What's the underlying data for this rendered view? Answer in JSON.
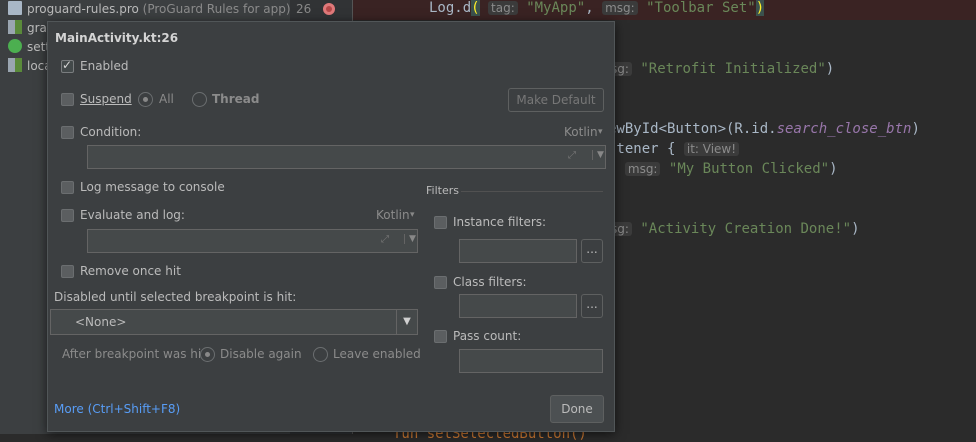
{
  "tree": {
    "items": [
      {
        "label": "proguard-rules.pro",
        "hint": "(ProGuard Rules for app)",
        "icon": "file-icon"
      },
      {
        "label": "grad",
        "hint": "",
        "icon": "gradle-icon"
      },
      {
        "label": "setti",
        "hint": "",
        "icon": "settings-gradle-icon"
      },
      {
        "label": "loca",
        "hint": "",
        "icon": "properties-icon"
      }
    ]
  },
  "gutter": {
    "line_number": "26"
  },
  "code": {
    "line1": {
      "fn": "Log.d",
      "tag_hint": "tag:",
      "tag": "\"MyApp\"",
      "msg_hint": "msg:",
      "msg": "\"Toolbar Set\""
    },
    "line2": {
      "msg_hint": "sg:",
      "msg": "\"Retrofit Initialized\""
    },
    "line3": {
      "pre": "ewById<Button>(R.id.",
      "id": "search_close_btn",
      "post": ")"
    },
    "line4": {
      "pre": "stener {",
      "hint": "it: View!"
    },
    "line5": {
      "pre": ",",
      "msg_hint": "msg:",
      "msg": "\"My Button Clicked\"",
      "post": ")"
    },
    "line6": {
      "msg_hint": "sg:",
      "msg": "\"Activity Creation Done!\"",
      "post": ")"
    },
    "line7": {
      "text": "fun setSelectedButton()"
    }
  },
  "dialog": {
    "title": "MainActivity.kt:26",
    "enabled": "Enabled",
    "suspend": "Suspend",
    "all": "All",
    "thread": "Thread",
    "make_default": "Make Default",
    "condition": "Condition:",
    "kotlin": "Kotlin",
    "log_message": "Log message to console",
    "evaluate_log": "Evaluate and log:",
    "kotlin2": "Kotlin",
    "remove_once_hit": "Remove once hit",
    "disabled_until": "Disabled until selected breakpoint is hit:",
    "none_option": "<None>",
    "after_hit": "After breakpoint was hit",
    "disable_again": "Disable again",
    "leave_enabled": "Leave enabled",
    "filters": "Filters",
    "instance_filters": "Instance filters:",
    "class_filters": "Class filters:",
    "pass_count": "Pass count:",
    "more": "More (Ctrl+Shift+F8)",
    "done": "Done",
    "ellipsis": "...",
    "link_color": "#589df6"
  }
}
